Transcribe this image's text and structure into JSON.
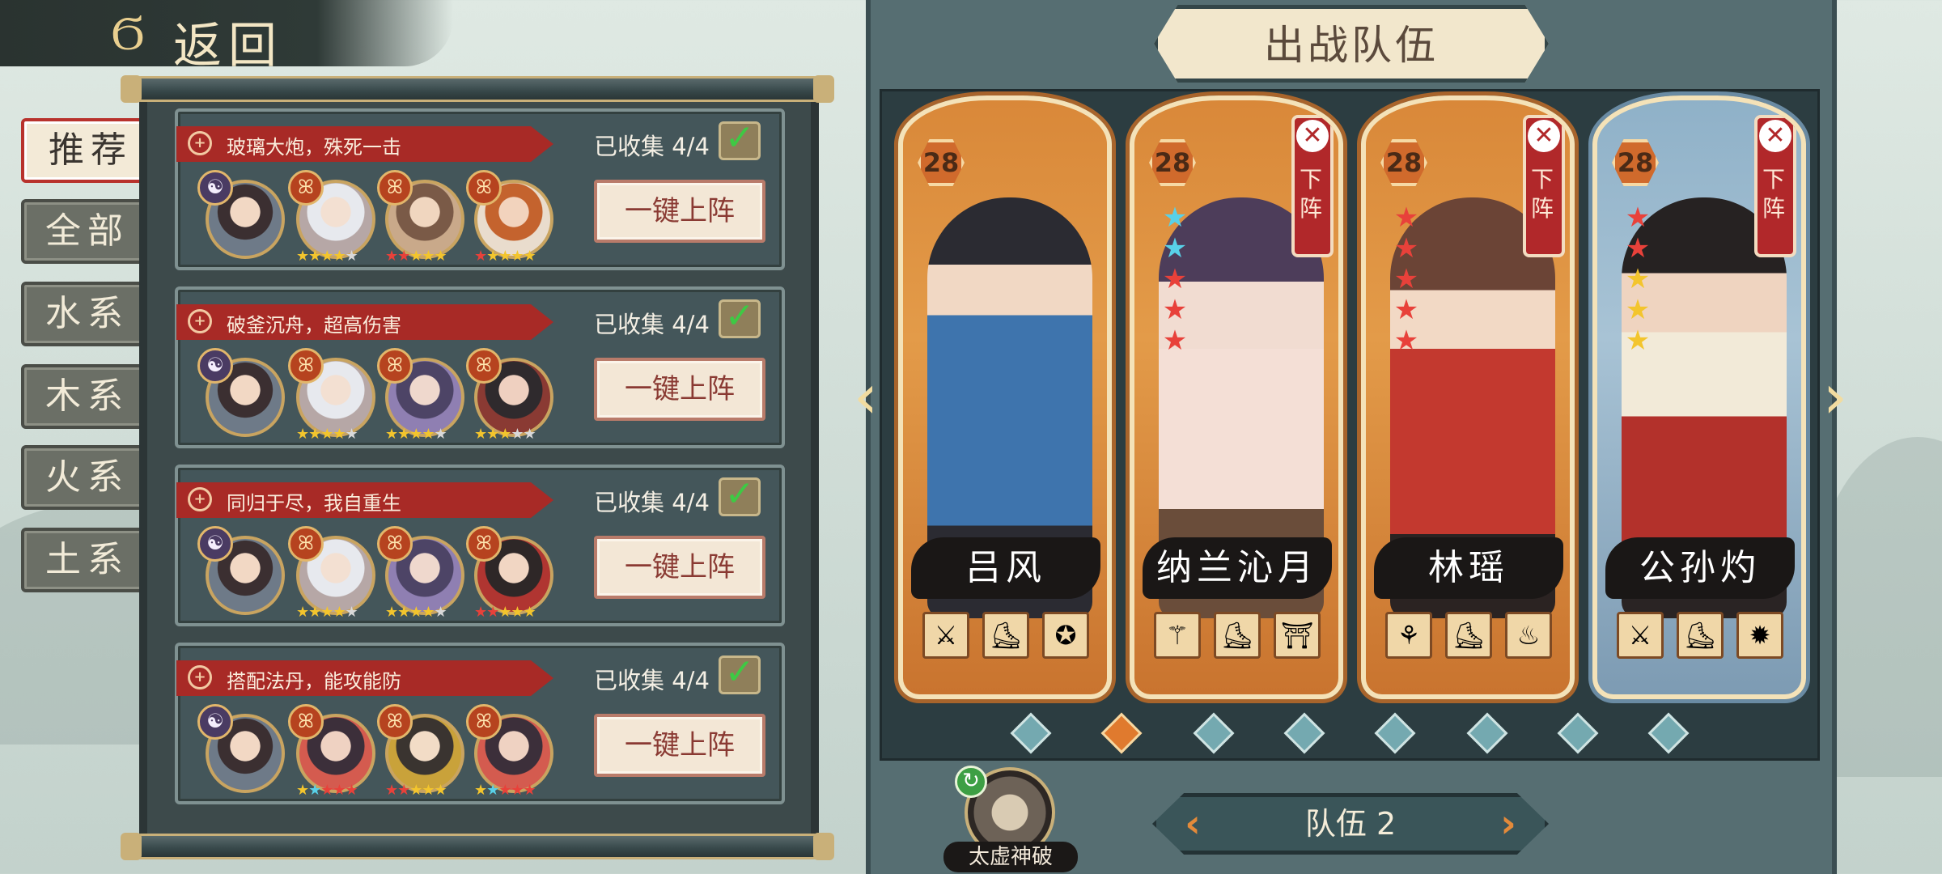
{
  "header": {
    "back_icon": "cloud-swirl-icon",
    "back_label": "返回"
  },
  "categories": [
    {
      "label": "推荐",
      "active": true
    },
    {
      "label": "全部",
      "active": false
    },
    {
      "label": "水系",
      "active": false
    },
    {
      "label": "木系",
      "active": false
    },
    {
      "label": "火系",
      "active": false
    },
    {
      "label": "土系",
      "active": false
    }
  ],
  "recommended_teams": [
    {
      "title": "玻璃大炮，殊死一击",
      "collected": "已收集 4/4",
      "button": "一键上阵"
    },
    {
      "title": "破釜沉舟，超高伤害",
      "collected": "已收集 4/4",
      "button": "一键上阵"
    },
    {
      "title": "同归于尽，我自重生",
      "collected": "已收集 4/4",
      "button": "一键上阵"
    },
    {
      "title": "搭配法丹，能攻能防",
      "collected": "已收集 4/4",
      "button": "一键上阵"
    }
  ],
  "formation": {
    "title": "出战队伍",
    "heroes": [
      {
        "name": "吕风",
        "level": "28",
        "remove_label": "",
        "stars": ""
      },
      {
        "name": "纳兰沁月",
        "level": "28",
        "remove_label": "下阵",
        "stars": ""
      },
      {
        "name": "林瑶",
        "level": "28",
        "remove_label": "下阵",
        "stars": ""
      },
      {
        "name": "公孙灼",
        "level": "28",
        "remove_label": "下阵",
        "stars": ""
      }
    ],
    "team_label": "队伍 2",
    "skill_label": "太虚神破",
    "page_count": 8,
    "active_page": 2,
    "colors": {
      "accent": "#e07a2e",
      "remove": "#b1282a",
      "banner": "#a82a26"
    }
  }
}
